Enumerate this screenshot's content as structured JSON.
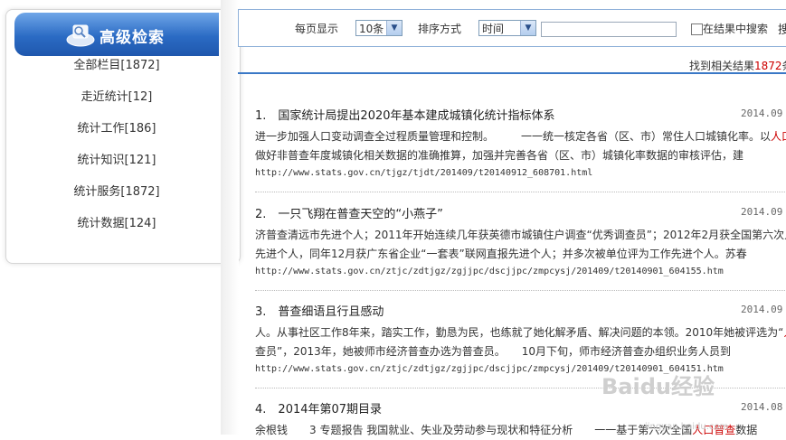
{
  "sidebar": {
    "title": "高级检索",
    "items": [
      {
        "label": "全部栏目[1872]"
      },
      {
        "label": "走近统计[12]"
      },
      {
        "label": "统计工作[186]"
      },
      {
        "label": "统计知识[121]"
      },
      {
        "label": "统计服务[1872]"
      },
      {
        "label": "统计数据[124]"
      }
    ]
  },
  "toolbar": {
    "per_page_label": "每页显示",
    "per_page_value": "10条",
    "sort_label": "排序方式",
    "sort_value": "时间",
    "search_value": "",
    "within_results_label": "在结果中搜索",
    "search_button_label": "搜"
  },
  "summary": {
    "prefix": "找到相关结果",
    "count": "1872",
    "suffix": "条"
  },
  "results": [
    {
      "index": "1.",
      "title": "国家统计局提出2020年基本建成城镇化统计指标体系",
      "date": "2014.09",
      "desc1_a": "进一步加强人口变动调查全过程质量管理和控制。　　　一一统一核定各省（区、市）常住人口城镇化率。以",
      "desc1_hl": "人口",
      "desc2": "做好非普查年度城镇化相关数据的准确推算，加强并完善各省（区、市）城镇化率数据的审核评估，建",
      "url": "http://www.stats.gov.cn/tjgz/tjdt/201409/t20140912_608701.html"
    },
    {
      "index": "2.",
      "title": "一只飞翔在普查天空的“小燕子”",
      "date": "2014.09",
      "desc1": "济普查清远市先进个人；2011年开始连续几年获英德市城镇住户调查“优秀调查员”；2012年2月获全国第六次人",
      "desc2": "先进个人，同年12月获广东省企业“一套表”联网直报先进个人；并多次被单位评为工作先进个人。苏春",
      "url": "http://www.stats.gov.cn/ztjc/zdtjgz/zgjjpc/dscjjpc/zmpcysj/201409/t20140901_604155.htm"
    },
    {
      "index": "3.",
      "title": "普查细语且行且感动",
      "date": "2014.09",
      "desc1_a": "人。从事社区工作8年来，踏实工作，勤恳为民，也练就了她化解矛盾、解决问题的本领。2010年她被评选为“",
      "desc1_hl": "人",
      "desc2": "查员”，2013年，她被师市经济普查办选为普查员。　　10月下旬，师市经济普查办组织业务人员到",
      "url": "http://www.stats.gov.cn/ztjc/zdtjgz/zgjjpc/dscjjpc/zmpcysj/201409/t20140901_604151.htm"
    },
    {
      "index": "4.",
      "title": "2014年第07期目录",
      "date": "2014.08",
      "desc1_a": "余根钱　　3 专题报告 我国就业、失业及劳动参与现状和特征分析　　一一基于第六次全国",
      "desc1_hl": "人口普查",
      "desc1_b": "数据"
    }
  ],
  "watermark": {
    "brand": "Baidu经验",
    "site": "jingyan.baidu.com"
  },
  "colors": {
    "accent_blue": "#2b6bc4",
    "highlight_red": "#cc0000"
  }
}
